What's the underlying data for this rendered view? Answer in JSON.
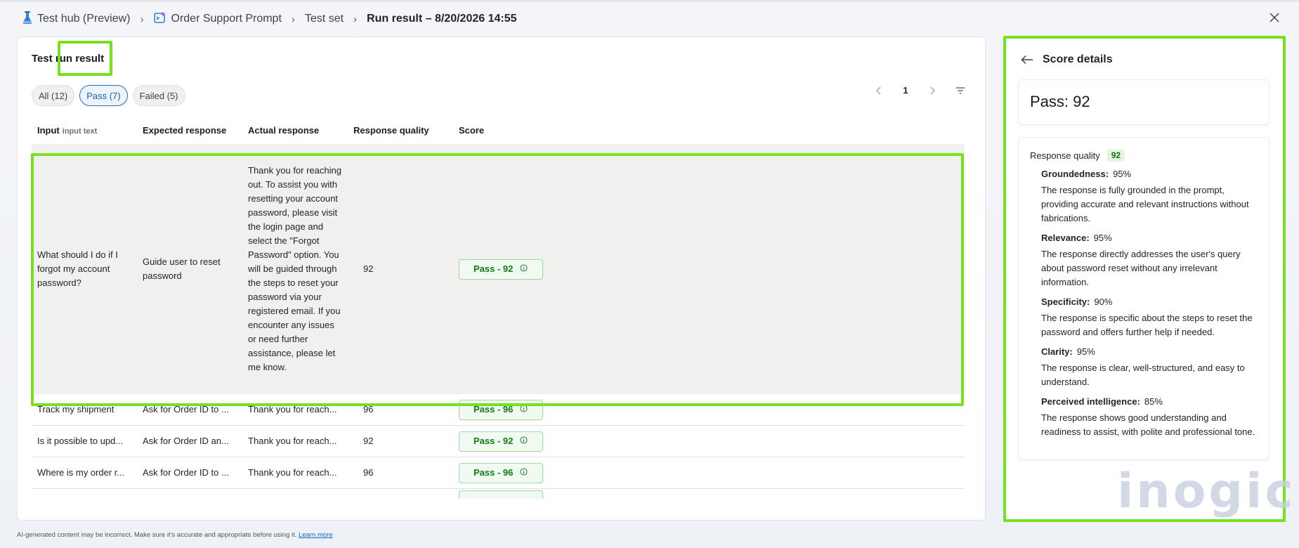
{
  "breadcrumb": {
    "items": [
      {
        "label": "Test hub (Preview)"
      },
      {
        "label": "Order Support Prompt"
      },
      {
        "label": "Test set"
      },
      {
        "label": "Run result – 8/20/2026 14:55"
      }
    ]
  },
  "main": {
    "title": "Test run result",
    "filters": {
      "all": "All (12)",
      "pass": "Pass (7)",
      "failed": "Failed (5)"
    },
    "pager": {
      "page": "1"
    },
    "columns": {
      "input": "Input",
      "input_sub": "input text",
      "expected": "Expected response",
      "actual": "Actual response",
      "quality": "Response quality",
      "score": "Score"
    },
    "rows": [
      {
        "input": "What should I do if I forgot my account password?",
        "expected": "Guide user to reset password",
        "actual": "Thank you for reaching out. To assist you with resetting your account password, please visit the login page and select the \"Forgot Password\" option. You will be guided through the steps to reset your password via your registered email. If you encounter any issues or need further assistance, please let me know.",
        "quality": "92",
        "score": "Pass - 92"
      },
      {
        "input": "Track my shipment",
        "expected": "Ask for Order ID to ...",
        "actual": "Thank you for reach...",
        "quality": "96",
        "score": "Pass - 96"
      },
      {
        "input": "Is it possible to upd...",
        "expected": "Ask for Order ID an...",
        "actual": "Thank you for reach...",
        "quality": "92",
        "score": "Pass - 92"
      },
      {
        "input": "Where is my order r...",
        "expected": "Ask for Order ID to ...",
        "actual": "Thank you for reach...",
        "quality": "96",
        "score": "Pass - 96"
      }
    ]
  },
  "details": {
    "title": "Score details",
    "pass_score": "Pass: 92",
    "response_quality_label": "Response quality",
    "response_quality_value": "92",
    "metrics": [
      {
        "name": "Groundedness:",
        "value": "95%",
        "desc": "The response is fully grounded in the prompt, providing accurate and relevant instructions without fabrications."
      },
      {
        "name": "Relevance:",
        "value": "95%",
        "desc": "The response directly addresses the user's query about password reset without any irrelevant information."
      },
      {
        "name": "Specificity:",
        "value": "90%",
        "desc": "The response is specific about the steps to reset the password and offers further help if needed."
      },
      {
        "name": "Clarity:",
        "value": "95%",
        "desc": "The response is clear, well-structured, and easy to understand."
      },
      {
        "name": "Perceived intelligence:",
        "value": "85%",
        "desc": "The response shows good understanding and readiness to assist, with polite and professional tone."
      }
    ]
  },
  "footer": {
    "disclaimer": "AI-generated content may be incorrect. Make sure it's accurate and appropriate before using it.",
    "learn_more": "Learn more"
  },
  "watermark": "inogic",
  "colors": {
    "highlight": "#76e21f",
    "pass_green": "#107c10",
    "accent_blue": "#2e6bb4"
  },
  "icons": {
    "test_hub": "flask-icon",
    "prompt": "prompt-icon",
    "close": "close-icon",
    "back": "arrow-left-icon",
    "filter": "filter-icon",
    "info": "info-icon"
  }
}
